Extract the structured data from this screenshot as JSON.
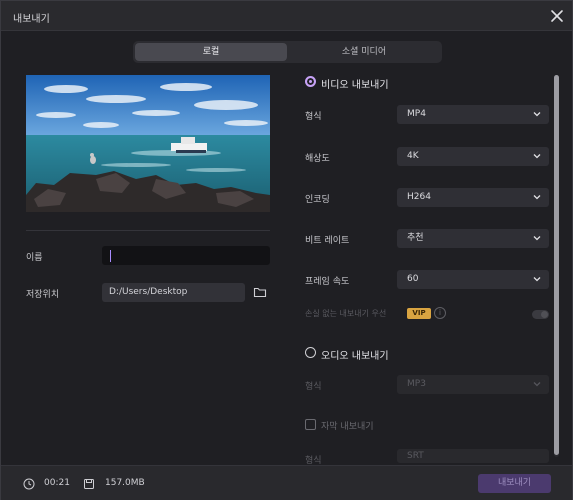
{
  "window": {
    "title": "내보내기"
  },
  "tabs": [
    {
      "label": "로컬"
    },
    {
      "label": "소셜 미디어"
    }
  ],
  "left": {
    "name_label": "이름",
    "name_value": "",
    "location_label": "저장위치",
    "location_value": "D:/Users/Desktop"
  },
  "video": {
    "header": "비디오 내보내기",
    "fields": {
      "format": {
        "label": "형식",
        "value": "MP4"
      },
      "resolution": {
        "label": "해상도",
        "value": "4K"
      },
      "encoding": {
        "label": "인코딩",
        "value": "H264"
      },
      "bitrate": {
        "label": "비트 레이트",
        "value": "추천"
      },
      "framerate": {
        "label": "프레임 속도",
        "value": "60"
      }
    },
    "lossless_label": "손실 없는 내보내기 우선",
    "vip_badge": "VIP",
    "info": "i",
    "lossless_enabled": false
  },
  "audio": {
    "header": "오디오 내보내기",
    "format_label": "형식",
    "format_value": "MP3"
  },
  "subtitle": {
    "header": "자막 내보내기",
    "format_label": "형식",
    "format_value": "SRT"
  },
  "footer": {
    "duration": "00:21",
    "size": "157.0MB",
    "export_label": "내보내기"
  },
  "colors": {
    "accent": "#c7a2f6",
    "vip": "#d9a441",
    "export_button": "#4b3a6e"
  },
  "icons": [
    "close-icon",
    "folder-icon",
    "chevron-down-icon",
    "info-icon",
    "clock-icon",
    "disk-icon"
  ]
}
